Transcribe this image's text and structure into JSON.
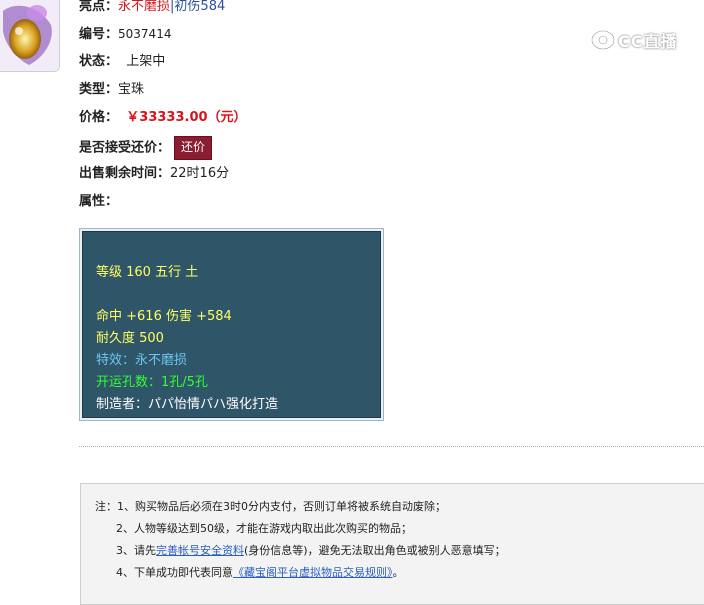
{
  "item": {
    "highlight_label": "亮点：",
    "highlight_main": "永不磨损",
    "highlight_sep": "|",
    "highlight_extra": "初伤584",
    "id_label": "编号：",
    "id_value": "5037414",
    "status_label": "状态：",
    "status_value": "上架中",
    "type_label": "类型：",
    "type_value": "宝珠",
    "price_label": "价格：",
    "price_value": "￥33333.00（元）",
    "bargain_label": "是否接受还价：",
    "bargain_button": "还价",
    "time_label": "出售剩余时间：",
    "time_value": "22时16分",
    "attr_label": "属性："
  },
  "props": {
    "line1": "等级 160 五行 土",
    "line2": "命中 +616 伤害 +584",
    "line3": "耐久度 500",
    "line4": "特效：永不磨损",
    "line5": "开运孔数：1孔/5孔",
    "line6": "制造者：パパ怡情パハ强化打造"
  },
  "watermark": {
    "text": "CC直播"
  },
  "notes": {
    "n1": "注：1、购买物品后必须在3时0分内支付，否则订单将被系统自动废除；",
    "n2": "2、人物等级达到50级，才能在游戏内取出此次购买的物品；",
    "n3_pre": "3、请先",
    "n3_link": "完善帐号安全资料",
    "n3_post": "(身份信息等)，避免无法取出角色或被别人恶意填写；",
    "n4_pre": "4、下单成功即代表同意",
    "n4_link": "《藏宝阁平台虚拟物品交易规则》",
    "n4_post": "。"
  },
  "colors": {
    "highlight_red": "#d8141c",
    "bargain_bg": "#8a1d2f",
    "props_bg": "#2f5568",
    "props_yellow": "#ffff66",
    "props_cyan": "#6cc6f0",
    "props_green": "#33ff33"
  }
}
